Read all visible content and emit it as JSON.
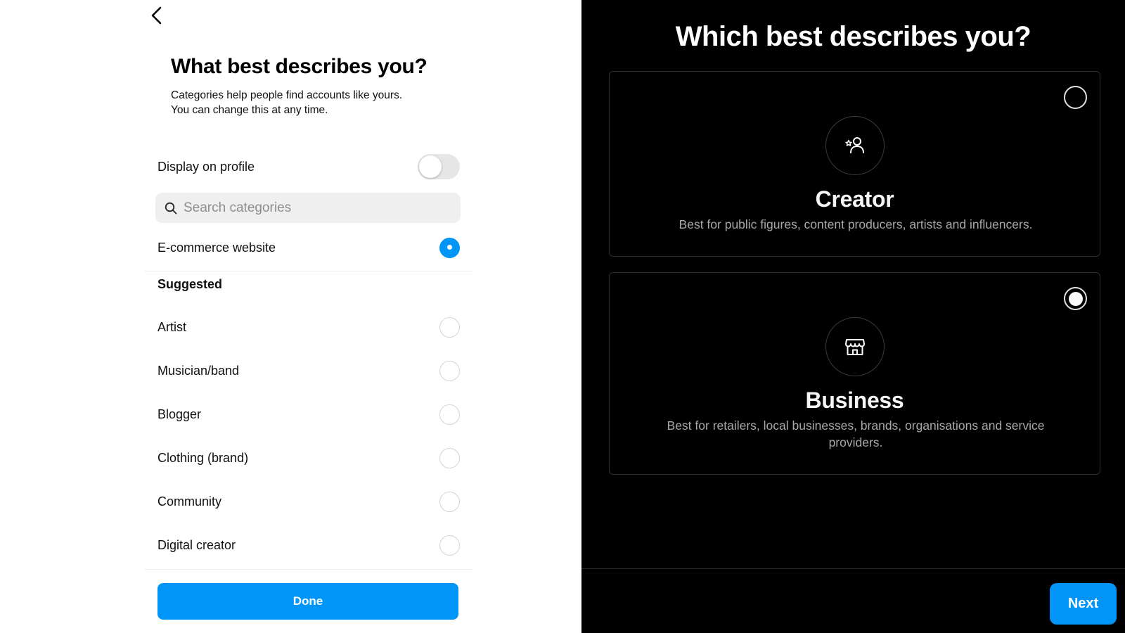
{
  "left_panel": {
    "title": "What best describes you?",
    "subtitle_line1": "Categories help people find accounts like yours.",
    "subtitle_line2": "You can change this at any time.",
    "display_on_profile": {
      "label": "Display on profile",
      "enabled": false
    },
    "search": {
      "placeholder": "Search categories",
      "value": ""
    },
    "selected_category": {
      "label": "E-commerce website",
      "selected": true
    },
    "suggested_heading": "Suggested",
    "suggested": [
      {
        "label": "Artist",
        "selected": false
      },
      {
        "label": "Musician/band",
        "selected": false
      },
      {
        "label": "Blogger",
        "selected": false
      },
      {
        "label": "Clothing (brand)",
        "selected": false
      },
      {
        "label": "Community",
        "selected": false
      },
      {
        "label": "Digital creator",
        "selected": false
      }
    ],
    "done_label": "Done",
    "accent_color": "#0095f6"
  },
  "right_panel": {
    "title": "Which best describes you?",
    "options": [
      {
        "title": "Creator",
        "description": "Best for public figures, content producers, artists and influencers.",
        "icon": "creator-person-star-icon",
        "selected": false
      },
      {
        "title": "Business",
        "description": "Best for retailers, local businesses, brands, organisations and service providers.",
        "icon": "storefront-icon",
        "selected": true
      }
    ],
    "next_label": "Next",
    "accent_color": "#0095f6"
  }
}
